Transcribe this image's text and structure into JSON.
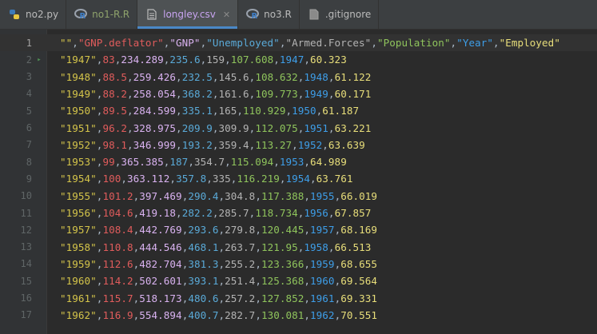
{
  "tabs": [
    {
      "label": "no2.py",
      "icon": "python-file-icon",
      "active": false
    },
    {
      "label": "no1-R.R",
      "icon": "r-file-icon",
      "active": false
    },
    {
      "label": "longley.csv",
      "icon": "csv-file-icon",
      "active": true
    },
    {
      "label": "no3.R",
      "icon": "r-file-icon",
      "active": false
    },
    {
      "label": ".gitignore",
      "icon": "text-file-icon",
      "active": false
    }
  ],
  "close_glyph": "✕",
  "column_colors": [
    "#d4c44a",
    "#e05c5c",
    "#d9b2f0",
    "#5aaad8",
    "#b3b3b3",
    "#8fc45c",
    "#3e9ee8",
    "#e8de7a"
  ],
  "editor": {
    "lines": [
      {
        "number": "1",
        "cells": [
          "\"\"",
          "\"GNP.deflator\"",
          "\"GNP\"",
          "\"Unemployed\"",
          "\"Armed.Forces\"",
          "\"Population\"",
          "\"Year\"",
          "\"Employed\""
        ]
      },
      {
        "number": "2",
        "cells": [
          "\"1947\"",
          "83",
          "234.289",
          "235.6",
          "159",
          "107.608",
          "1947",
          "60.323"
        ]
      },
      {
        "number": "3",
        "cells": [
          "\"1948\"",
          "88.5",
          "259.426",
          "232.5",
          "145.6",
          "108.632",
          "1948",
          "61.122"
        ]
      },
      {
        "number": "4",
        "cells": [
          "\"1949\"",
          "88.2",
          "258.054",
          "368.2",
          "161.6",
          "109.773",
          "1949",
          "60.171"
        ]
      },
      {
        "number": "5",
        "cells": [
          "\"1950\"",
          "89.5",
          "284.599",
          "335.1",
          "165",
          "110.929",
          "1950",
          "61.187"
        ]
      },
      {
        "number": "6",
        "cells": [
          "\"1951\"",
          "96.2",
          "328.975",
          "209.9",
          "309.9",
          "112.075",
          "1951",
          "63.221"
        ]
      },
      {
        "number": "7",
        "cells": [
          "\"1952\"",
          "98.1",
          "346.999",
          "193.2",
          "359.4",
          "113.27",
          "1952",
          "63.639"
        ]
      },
      {
        "number": "8",
        "cells": [
          "\"1953\"",
          "99",
          "365.385",
          "187",
          "354.7",
          "115.094",
          "1953",
          "64.989"
        ]
      },
      {
        "number": "9",
        "cells": [
          "\"1954\"",
          "100",
          "363.112",
          "357.8",
          "335",
          "116.219",
          "1954",
          "63.761"
        ]
      },
      {
        "number": "10",
        "cells": [
          "\"1955\"",
          "101.2",
          "397.469",
          "290.4",
          "304.8",
          "117.388",
          "1955",
          "66.019"
        ]
      },
      {
        "number": "11",
        "cells": [
          "\"1956\"",
          "104.6",
          "419.18",
          "282.2",
          "285.7",
          "118.734",
          "1956",
          "67.857"
        ]
      },
      {
        "number": "12",
        "cells": [
          "\"1957\"",
          "108.4",
          "442.769",
          "293.6",
          "279.8",
          "120.445",
          "1957",
          "68.169"
        ]
      },
      {
        "number": "13",
        "cells": [
          "\"1958\"",
          "110.8",
          "444.546",
          "468.1",
          "263.7",
          "121.95",
          "1958",
          "66.513"
        ]
      },
      {
        "number": "14",
        "cells": [
          "\"1959\"",
          "112.6",
          "482.704",
          "381.3",
          "255.2",
          "123.366",
          "1959",
          "68.655"
        ]
      },
      {
        "number": "15",
        "cells": [
          "\"1960\"",
          "114.2",
          "502.601",
          "393.1",
          "251.4",
          "125.368",
          "1960",
          "69.564"
        ]
      },
      {
        "number": "16",
        "cells": [
          "\"1961\"",
          "115.7",
          "518.173",
          "480.6",
          "257.2",
          "127.852",
          "1961",
          "69.331"
        ]
      },
      {
        "number": "17",
        "cells": [
          "\"1962\"",
          "116.9",
          "554.894",
          "400.7",
          "282.7",
          "130.081",
          "1962",
          "70.551"
        ]
      }
    ]
  }
}
